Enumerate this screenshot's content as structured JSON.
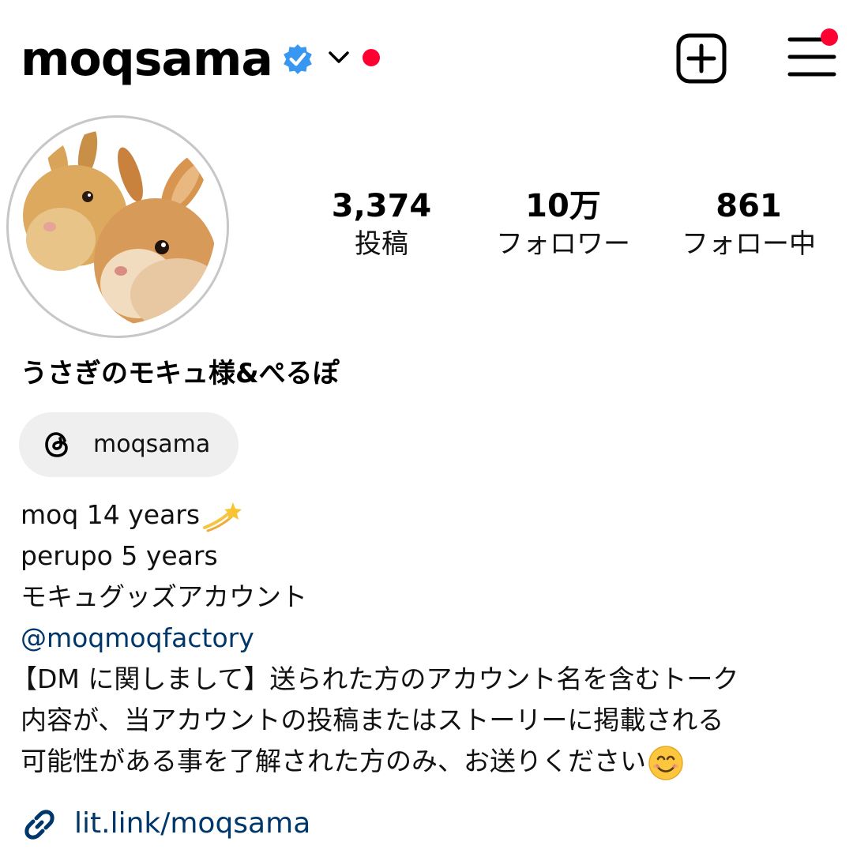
{
  "header": {
    "username": "moqsama",
    "verified_icon": "verified-badge-icon",
    "chevron_icon": "chevron-down-icon",
    "create_icon": "plus-square-icon",
    "menu_icon": "hamburger-menu-icon",
    "notification_color": "#ff0033"
  },
  "profile": {
    "avatar": "avatar-rabbits",
    "stats": [
      {
        "value": "3,374",
        "label": "投稿"
      },
      {
        "value": "10万",
        "label": "フォロワー"
      },
      {
        "value": "861",
        "label": "フォロー中"
      }
    ],
    "display_name": "うさぎのモキュ様&ぺるぽ",
    "threads": {
      "icon": "threads-icon",
      "label": "moqsama"
    },
    "bio": {
      "line1": "moq 14 years",
      "line1_emoji": "dizzy-star-emoji",
      "line2": "perupo 5 years",
      "line3": "モキュグッズアカウント",
      "mention": "@moqmoqfactory",
      "line5": "【DM に関しまして】送られた方のアカウント名を含むトーク",
      "line6": "内容が、当アカウントの投稿またはストーリーに掲載される",
      "line7": "可能性がある事を了解された方のみ、お送りください",
      "line7_emoji": "smiling-face-emoji"
    },
    "link": {
      "icon": "link-icon",
      "text": "lit.link/moqsama",
      "color": "#00376b"
    }
  }
}
